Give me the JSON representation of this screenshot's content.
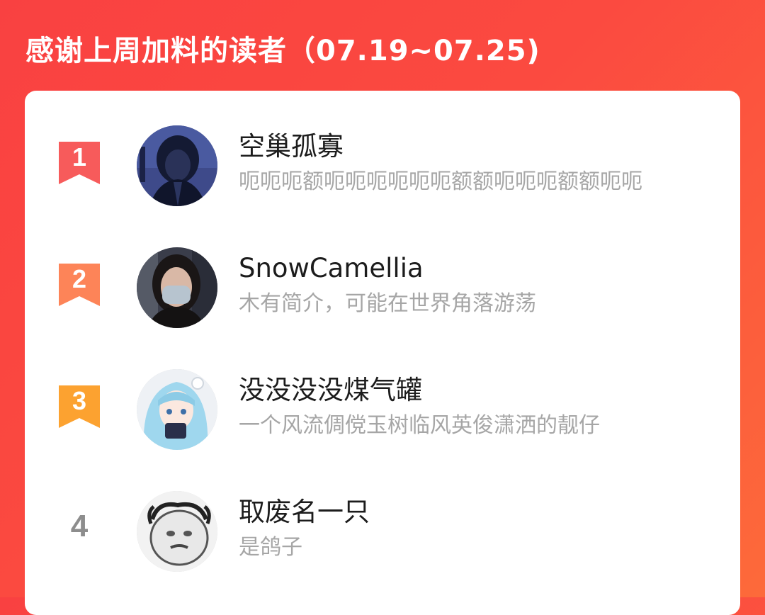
{
  "header": {
    "title": "感谢上周加料的读者（07.19~07.25)"
  },
  "colors": {
    "background_start": "#f94141",
    "background_end": "#fd6a3a",
    "rank1": "#f75b5b",
    "rank2": "#fd8458",
    "rank3": "#fca230",
    "rank_plain": "#8d8d8d",
    "name": "#1c1c1c",
    "bio": "#a6a6a6"
  },
  "readers": [
    {
      "rank": "1",
      "name": "空巢孤寡",
      "bio": "呃呃呃额呃呃呃呃呃呃额额呃呃呃额额呃呃",
      "avatar": "dark-anime-girl-avatar"
    },
    {
      "rank": "2",
      "name": "SnowCamellia",
      "bio": "木有简介，可能在世界角落游荡",
      "avatar": "masked-person-photo-avatar"
    },
    {
      "rank": "3",
      "name": "没没没没煤气罐",
      "bio": "一个风流倜傥玉树临风英俊潇洒的靓仔",
      "avatar": "blue-hair-anime-avatar"
    },
    {
      "rank": "4",
      "name": "取废名一只",
      "bio": "是鸽子",
      "avatar": "meme-face-avatar"
    }
  ]
}
